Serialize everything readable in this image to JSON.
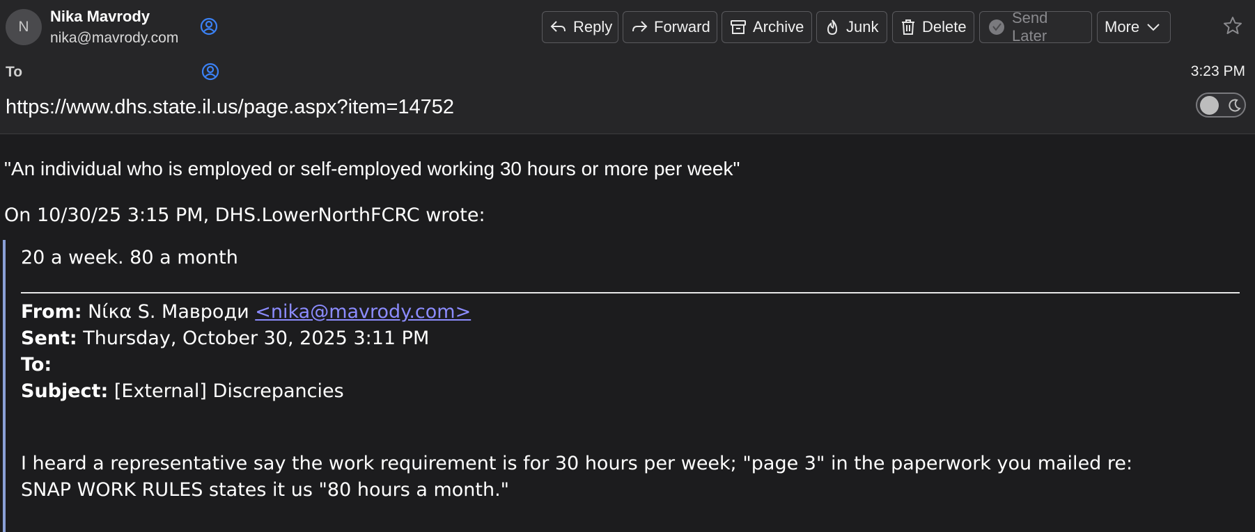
{
  "header": {
    "avatar_initial": "N",
    "sender_name": "Nika Mavrody",
    "sender_email": "nika@mavrody.com",
    "to_label": "To",
    "time": "3:23 PM",
    "subject": "https://www.dhs.state.il.us/page.aspx?item=14752"
  },
  "toolbar": {
    "reply": "Reply",
    "forward": "Forward",
    "archive": "Archive",
    "junk": "Junk",
    "delete": "Delete",
    "send_later": "Send Later",
    "more": "More"
  },
  "body": {
    "quote": "\"An individual who is employed or self-employed working 30 hours or more per week\"",
    "wrote_line": "On 10/30/25 3:15 PM, DHS.LowerNorthFCRC wrote:",
    "reply_text": "20 a week. 80 a month",
    "from_label": "From:",
    "from_name": "Νίκα S. Мавроди",
    "from_email": "<nika@mavrody.com>",
    "sent_label": "Sent:",
    "sent_value": "Thursday, October 30, 2025 3:11 PM",
    "to_label": "To:",
    "subject_label": "Subject:",
    "subject_value": "[External] Discrepancies",
    "message_line1": "I heard a representative say the work requirement is for 30 hours per week; \"page 3\" in the paperwork you mailed re:",
    "message_line2": "SNAP WORK RULES states it us \"80 hours a month.\""
  },
  "colors": {
    "background": "#1c1c1e",
    "header_background": "#262628",
    "link": "#8c8cff",
    "quote_bar": "#8aa0d8",
    "contact_icon": "#3b82f6"
  }
}
